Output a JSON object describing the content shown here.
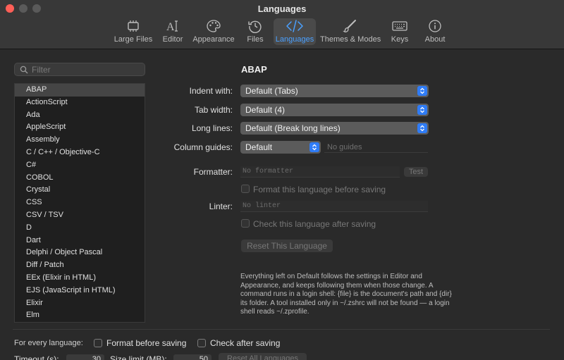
{
  "window": {
    "title": "Languages"
  },
  "toolbar": {
    "tabs": [
      {
        "label": "Large Files",
        "icon": "chip-icon"
      },
      {
        "label": "Editor",
        "icon": "text-cursor-icon"
      },
      {
        "label": "Appearance",
        "icon": "palette-icon"
      },
      {
        "label": "Files",
        "icon": "history-icon"
      },
      {
        "label": "Languages",
        "icon": "code-icon",
        "active": true
      },
      {
        "label": "Themes & Modes",
        "icon": "paintbrush-icon"
      },
      {
        "label": "Keys",
        "icon": "keyboard-icon"
      },
      {
        "label": "About",
        "icon": "info-icon"
      }
    ]
  },
  "sidebar": {
    "filter_placeholder": "Filter",
    "languages": [
      "ABAP",
      "ActionScript",
      "Ada",
      "AppleScript",
      "Assembly",
      "C / C++ / Objective-C",
      "C#",
      "COBOL",
      "Crystal",
      "CSS",
      "CSV / TSV",
      "D",
      "Dart",
      "Delphi / Object Pascal",
      "Diff / Patch",
      "EEx (Elixir in HTML)",
      "EJS (JavaScript in HTML)",
      "Elixir",
      "Elm"
    ],
    "selected": "ABAP"
  },
  "detail": {
    "title": "ABAP",
    "indent_label": "Indent with:",
    "indent_value": "Default (Tabs)",
    "tabwidth_label": "Tab width:",
    "tabwidth_value": "Default (4)",
    "longlines_label": "Long lines:",
    "longlines_value": "Default (Break long lines)",
    "guides_label": "Column guides:",
    "guides_value": "Default",
    "guides_placeholder": "No guides",
    "formatter_label": "Formatter:",
    "formatter_placeholder": "No formatter",
    "test_button": "Test",
    "format_on_save": "Format this language before saving",
    "linter_label": "Linter:",
    "linter_placeholder": "No linter",
    "check_on_save": "Check this language after saving",
    "reset_button": "Reset This Language",
    "note": "Everything left on Default follows the settings in Editor and Appearance, and keeps following them when those change. A command runs in a login shell: {file} is the document's path and {dir} its folder. A tool installed only in ~/.zshrc will not be found — a login shell reads ~/.zprofile."
  },
  "footer": {
    "every_language": "For every language:",
    "format_before_saving": "Format before saving",
    "check_after_saving": "Check after saving",
    "timeout_label": "Timeout (s):",
    "timeout_value": "30",
    "sizelimit_label": "Size limit (MB):",
    "sizelimit_value": "50",
    "reset_all": "Reset All Languages"
  },
  "colors": {
    "accent": "#2f7cf6",
    "active_tab_text": "#4aa0ff",
    "close_button": "#ff5f57"
  }
}
